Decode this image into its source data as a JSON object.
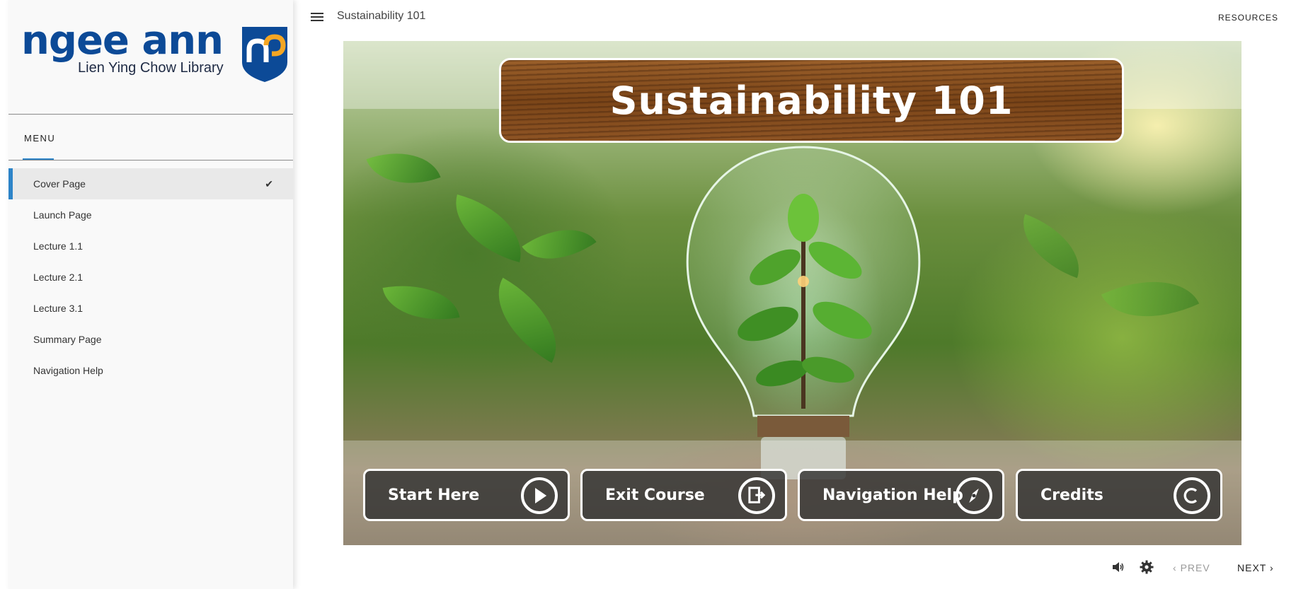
{
  "app": {
    "title": "Sustainability 101",
    "resources_label": "RESOURCES"
  },
  "logo": {
    "name": "ngee ann",
    "subtitle": "Lien Ying Chow Library"
  },
  "sidebar": {
    "menu_label": "MENU",
    "items": [
      {
        "label": "Cover Page",
        "active": true,
        "completed": true
      },
      {
        "label": "Launch Page"
      },
      {
        "label": "Lecture 1.1"
      },
      {
        "label": "Lecture 2.1"
      },
      {
        "label": "Lecture 3.1"
      },
      {
        "label": "Summary Page"
      },
      {
        "label": "Navigation Help"
      }
    ]
  },
  "stage": {
    "title": "Sustainability 101",
    "buttons": [
      {
        "label": "Start Here",
        "icon": "play-icon"
      },
      {
        "label": "Exit Course",
        "icon": "exit-icon"
      },
      {
        "label": "Navigation Help",
        "icon": "compass-icon"
      },
      {
        "label": "Credits",
        "icon": "copyright-icon"
      }
    ]
  },
  "controls": {
    "prev_label": "PREV",
    "next_label": "NEXT",
    "audio_icon": "audio-icon",
    "settings_icon": "gear-icon"
  },
  "colors": {
    "accent": "#2d84c8",
    "logo_blue": "#0c4a97",
    "logo_orange": "#f5a623"
  }
}
